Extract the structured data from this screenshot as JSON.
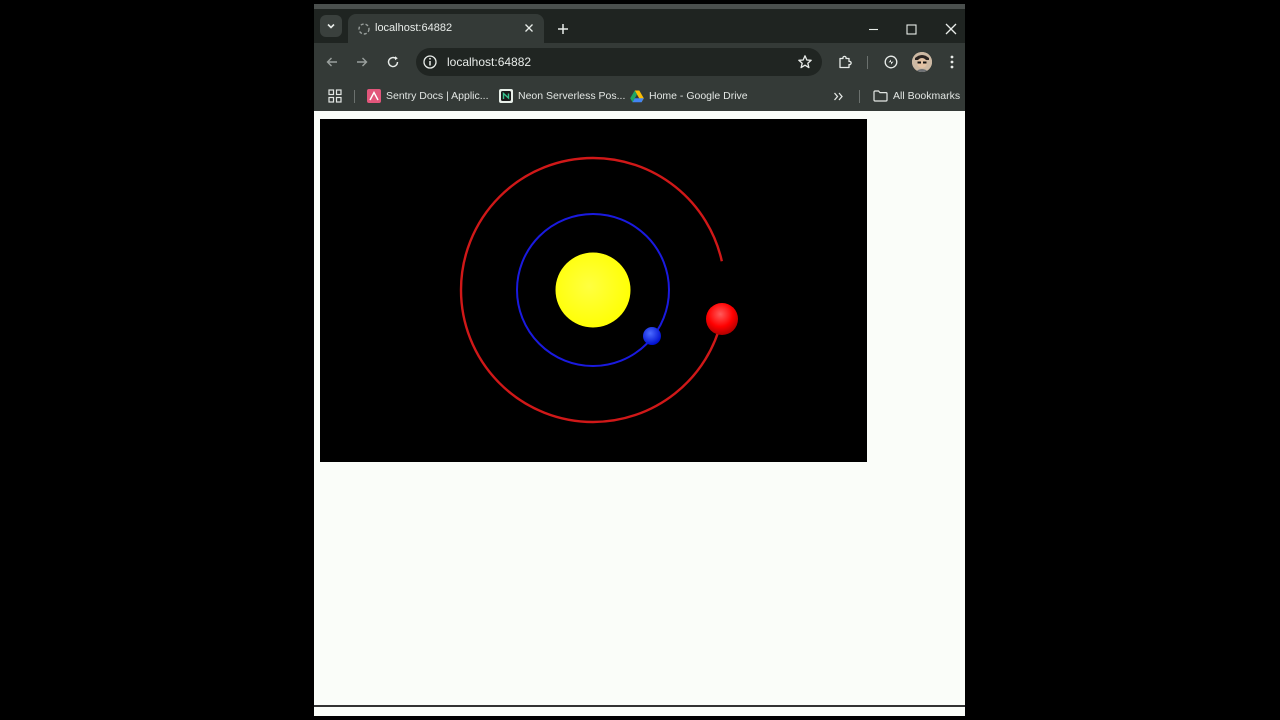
{
  "browser": {
    "tab": {
      "title": "localhost:64882"
    },
    "address_bar": {
      "url": "localhost:64882"
    },
    "bookmarks": [
      {
        "label": "Sentry Docs | Applic...",
        "icon": "sentry-icon"
      },
      {
        "label": "Neon Serverless Pos...",
        "icon": "neon-icon"
      },
      {
        "label": "Home - Google Drive",
        "icon": "google-drive-icon"
      }
    ],
    "all_bookmarks_label": "All Bookmarks"
  },
  "scene": {
    "sun_color": "#ffff00",
    "inner_orbit_color": "#1a1adf",
    "outer_orbit_color": "#d01818",
    "inner_planet_color": "#0a1cff",
    "outer_planet_color": "#ff0000",
    "background_color": "#000000"
  }
}
